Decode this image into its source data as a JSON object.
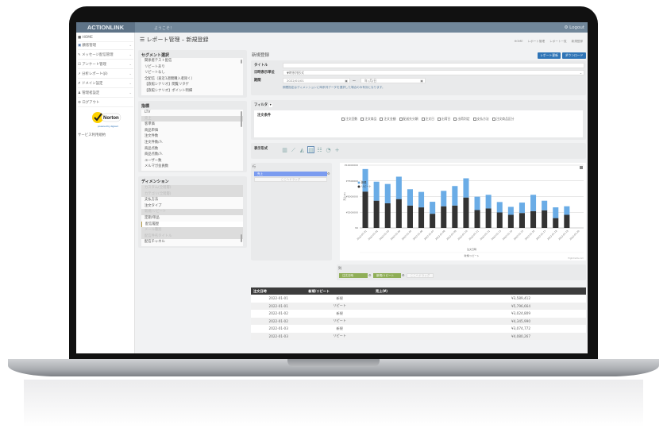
{
  "app": {
    "logo": "ACTIONLINK",
    "welcome": "ようこそ！",
    "logout": "Logout"
  },
  "sidebar": {
    "items": [
      {
        "label": "HOME",
        "icon": "home-icon"
      },
      {
        "label": "顧客管理",
        "icon": "users-icon"
      },
      {
        "label": "メッセージ配信管理",
        "icon": "pencil-icon"
      },
      {
        "label": "アンケート管理",
        "icon": "edit-icon"
      },
      {
        "label": "分析レポート(β)",
        "icon": "chart-icon"
      },
      {
        "label": "ドメイン設定",
        "icon": "wrench-icon"
      },
      {
        "label": "管理者設定",
        "icon": "user-icon"
      },
      {
        "label": "ログアウト",
        "icon": "gear-icon"
      }
    ],
    "norton": "Norton",
    "norton_sub": "powered by digicert",
    "terms": "サービス利用規約"
  },
  "page": {
    "title": "レポート管理 – 新規登録",
    "breadcrumb": [
      "HOME",
      "レポート管理",
      "レポート一覧",
      "新規登録"
    ]
  },
  "segment": {
    "title": "セグメント選択",
    "items": [
      "関係者テスト配信",
      "リピートあり",
      "リピートなし",
      "全配信（直近1週間購入者除く）",
      "【旅館シナリオ】閲覧リタゲ",
      "【旅館シナリオ】ポイント明細"
    ]
  },
  "metrics": {
    "title": "指標",
    "items": [
      "LTV",
      "売上",
      "客単価",
      "商品単価",
      "注文件数",
      "注文件数/人",
      "商品点数",
      "商品点数/人",
      "ユーザー数",
      "メルマガ会員数"
    ],
    "selected": "売上"
  },
  "dimension": {
    "title": "ディメンション",
    "items": [
      "カスタム(全階層)",
      "カテゴリ(全階層)",
      "支払方法",
      "注文タイプ",
      "新規/リピート",
      "定期/単品",
      "配信履歴",
      "メール種別",
      "配信件名タイトル",
      "配信チャネル"
    ]
  },
  "form": {
    "heading": "新規登録",
    "update_button": "レポート更新",
    "download_button": "ダウンロード",
    "title_label": "タイトル",
    "title_value": "",
    "unit_label": "日時表示単位",
    "unit_value": "▼時系列形式",
    "period_label": "期間",
    "date_from": "2022/01/01",
    "date_sep": "〜",
    "date_to_placeholder": "年 /月/日",
    "period_note": "期間指定はディメンションに時系列データを選択した場合のみ有効となります。"
  },
  "filter": {
    "label": "フィルタ",
    "toggle": "▾",
    "condition_label": "注文条件",
    "checkboxes": [
      "注文回数",
      "注文商品",
      "注文金額",
      "配送先分類",
      "注文日",
      "出荷日",
      "出荷判定",
      "支払方法",
      "注文商品区分"
    ]
  },
  "display": {
    "label": "表示形式",
    "icons": [
      "bar-chart-icon",
      "line-chart-icon",
      "area-chart-icon",
      "stacked-bar-icon",
      "table-icon",
      "pie-chart-icon",
      "plus-icon"
    ],
    "selected_index": 3
  },
  "pivot": {
    "row_label": "行",
    "row_chip": "売上",
    "drop_here": "ここへドラッグ",
    "col_label": "列",
    "col_chips": [
      "注文日時",
      "新規/リピート"
    ]
  },
  "chart_data": {
    "type": "bar",
    "stacked": true,
    "categories": [
      "2022-01-01",
      "2022-01-02",
      "2022-01-03",
      "2022-01-04",
      "2022-01-05",
      "2022-01-06",
      "2022-01-07",
      "2022-01-08",
      "2022-01-09",
      "2022-01-10",
      "2022-01-11",
      "2022-01-12",
      "2022-01-13",
      "2022-01-14",
      "2022-01-15",
      "2022-01-16",
      "2022-01-17",
      "2022-01-18",
      "2022-01-19",
      "2022-01-20"
    ],
    "series": [
      {
        "name": "新規",
        "color": "#6aace6",
        "values": [
          3589412,
          3024809,
          3074772,
          3570000,
          2600000,
          2460000,
          1910000,
          2460000,
          3110000,
          3060000,
          2130000,
          2170000,
          1660000,
          1270000,
          1660000,
          2600000,
          1530000,
          1710000,
          1360000,
          null
        ]
      },
      {
        "name": "リピート",
        "color": "#333333",
        "values": [
          5796664,
          4345990,
          3930000,
          4600000,
          3570000,
          3280000,
          2260000,
          3450000,
          3570000,
          4850000,
          2850000,
          3110000,
          2470000,
          2090000,
          2380000,
          2680000,
          2810000,
          1570000,
          2090000,
          null
        ]
      }
    ],
    "yticks": [
      "¥0",
      "¥2500000",
      "¥5000000",
      "¥7500000",
      "¥10000000"
    ],
    "ylim": [
      0,
      10000000
    ],
    "xlabel": "注文日時",
    "ylabel": "売上(¥)",
    "subtitle": "新規/リピート",
    "credit": "Highcharts.com",
    "legend": "top-left",
    "grid": true
  },
  "table": {
    "headers": [
      "注文日時",
      "新規/リピート",
      "売上(¥)"
    ],
    "rows": [
      [
        "2022-01-01",
        "新規",
        "¥3,589,412"
      ],
      [
        "2022-01-01",
        "リピート",
        "¥5,796,664"
      ],
      [
        "2022-01-02",
        "新規",
        "¥3,024,809"
      ],
      [
        "2022-01-02",
        "リピート",
        "¥4,345,990"
      ],
      [
        "2022-01-03",
        "新規",
        "¥3,074,772"
      ],
      [
        "2022-01-03",
        "リピート",
        "¥4,080,267"
      ]
    ]
  }
}
